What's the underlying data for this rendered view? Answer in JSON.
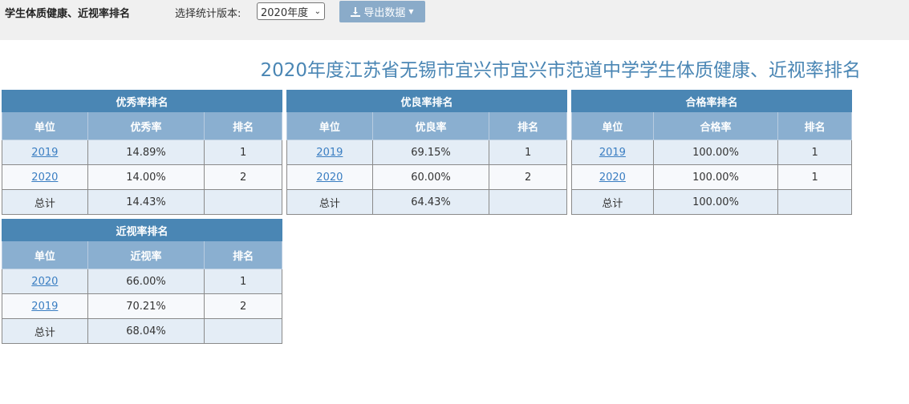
{
  "header": {
    "app_title": "学生体质健康、近视率排名",
    "version_label": "选择统计版本:",
    "version_selected": "2020年度",
    "export_label": "导出数据"
  },
  "page_title": "2020年度江苏省无锡市宜兴市宜兴市范道中学学生体质健康、近视率排名",
  "tables": {
    "excellent": {
      "caption": "优秀率排名",
      "columns": [
        "单位",
        "优秀率",
        "排名"
      ],
      "rows": [
        {
          "unit": "2019",
          "rate": "14.89%",
          "rank": "1"
        },
        {
          "unit": "2020",
          "rate": "14.00%",
          "rank": "2"
        }
      ],
      "total": {
        "label": "总计",
        "rate": "14.43%"
      }
    },
    "good": {
      "caption": "优良率排名",
      "columns": [
        "单位",
        "优良率",
        "排名"
      ],
      "rows": [
        {
          "unit": "2019",
          "rate": "69.15%",
          "rank": "1"
        },
        {
          "unit": "2020",
          "rate": "60.00%",
          "rank": "2"
        }
      ],
      "total": {
        "label": "总计",
        "rate": "64.43%"
      }
    },
    "pass": {
      "caption": "合格率排名",
      "columns": [
        "单位",
        "合格率",
        "排名"
      ],
      "rows": [
        {
          "unit": "2019",
          "rate": "100.00%",
          "rank": "1"
        },
        {
          "unit": "2020",
          "rate": "100.00%",
          "rank": "1"
        }
      ],
      "total": {
        "label": "总计",
        "rate": "100.00%"
      }
    },
    "myopia": {
      "caption": "近视率排名",
      "columns": [
        "单位",
        "近视率",
        "排名"
      ],
      "rows": [
        {
          "unit": "2020",
          "rate": "66.00%",
          "rank": "1"
        },
        {
          "unit": "2019",
          "rate": "70.21%",
          "rank": "2"
        }
      ],
      "total": {
        "label": "总计",
        "rate": "68.04%"
      }
    }
  },
  "colors": {
    "caption_bg": "#4a86b4",
    "header_bg": "#8aafd0",
    "title_color": "#4a86b4",
    "link_color": "#3a7ec2"
  }
}
